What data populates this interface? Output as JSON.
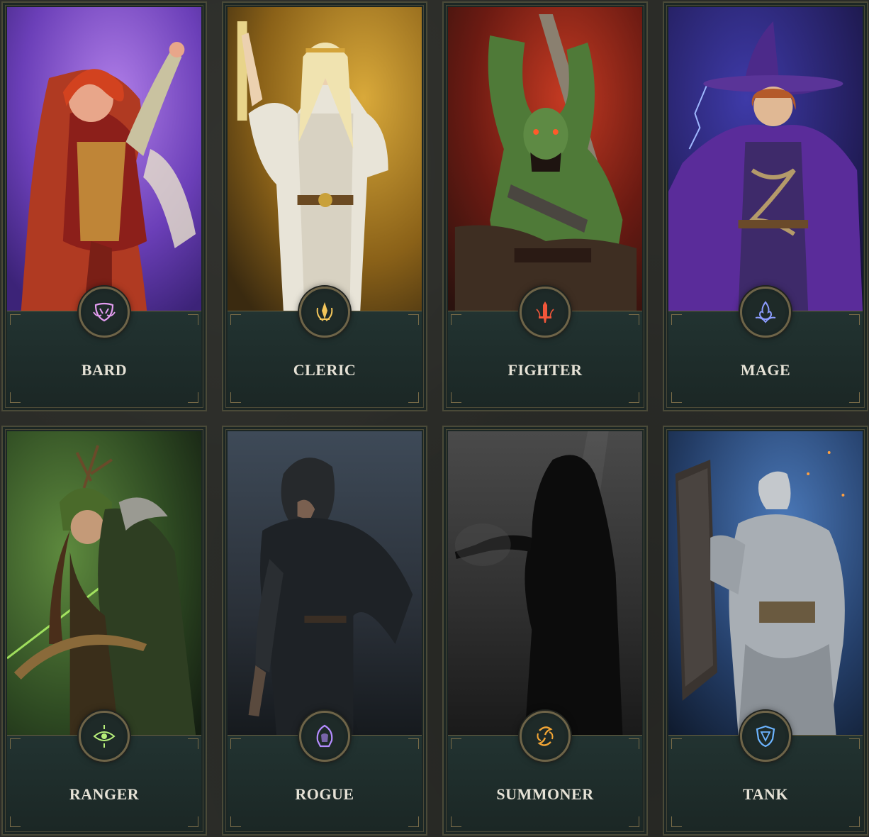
{
  "classes": [
    {
      "id": "bard",
      "label": "BARD",
      "icon": "bard-mask-icon",
      "color": "#e39cf0"
    },
    {
      "id": "cleric",
      "label": "CLERIC",
      "icon": "cleric-flame-icon",
      "color": "#f2c55a"
    },
    {
      "id": "fighter",
      "label": "FIGHTER",
      "icon": "fighter-sword-icon",
      "color": "#f0563a"
    },
    {
      "id": "mage",
      "label": "MAGE",
      "icon": "mage-flame-icon",
      "color": "#8c9cff"
    },
    {
      "id": "ranger",
      "label": "RANGER",
      "icon": "ranger-eye-icon",
      "color": "#b8f07a"
    },
    {
      "id": "rogue",
      "label": "ROGUE",
      "icon": "rogue-hood-icon",
      "color": "#b48cff"
    },
    {
      "id": "summoner",
      "label": "SUMMONER",
      "icon": "summoner-swirl-icon",
      "color": "#f2a535"
    },
    {
      "id": "tank",
      "label": "TANK",
      "icon": "tank-shield-icon",
      "color": "#6cb4ff"
    }
  ]
}
